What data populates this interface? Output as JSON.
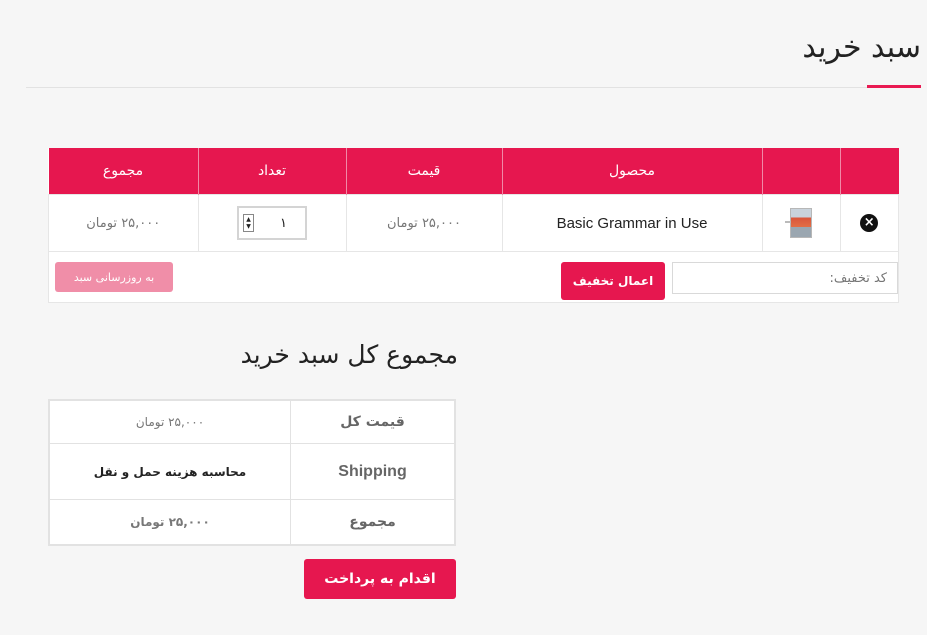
{
  "page": {
    "title": "سبد خرید"
  },
  "cart": {
    "headers": {
      "remove": "",
      "thumbnail": "",
      "product": "محصول",
      "price": "قیمت",
      "quantity": "تعداد",
      "subtotal": "مجموع"
    },
    "item": {
      "remove_icon": "×",
      "product": "Basic Grammar in Use",
      "price": "۲۵,۰۰۰ تومان",
      "quantity": "۱",
      "subtotal": "۲۵,۰۰۰ تومان"
    },
    "coupon_placeholder": "کد تخفیف:",
    "apply_coupon": "اعمال تخفیف",
    "update_cart": "به روزرسانی سبد"
  },
  "totals": {
    "title": "مجموع کل سبد خرید",
    "subtotal_label": "قیمت کل",
    "subtotal_value": "۲۵,۰۰۰ تومان",
    "shipping_label": "Shipping",
    "shipping_value": "محاسبه هزینه حمل و نقل",
    "total_label": "مجموع",
    "total_value": "۲۵,۰۰۰ تومان"
  },
  "checkout": {
    "button": "اقدام به پرداخت"
  },
  "colors": {
    "accent": "#e6174f",
    "accent_light": "#f08ea8"
  }
}
